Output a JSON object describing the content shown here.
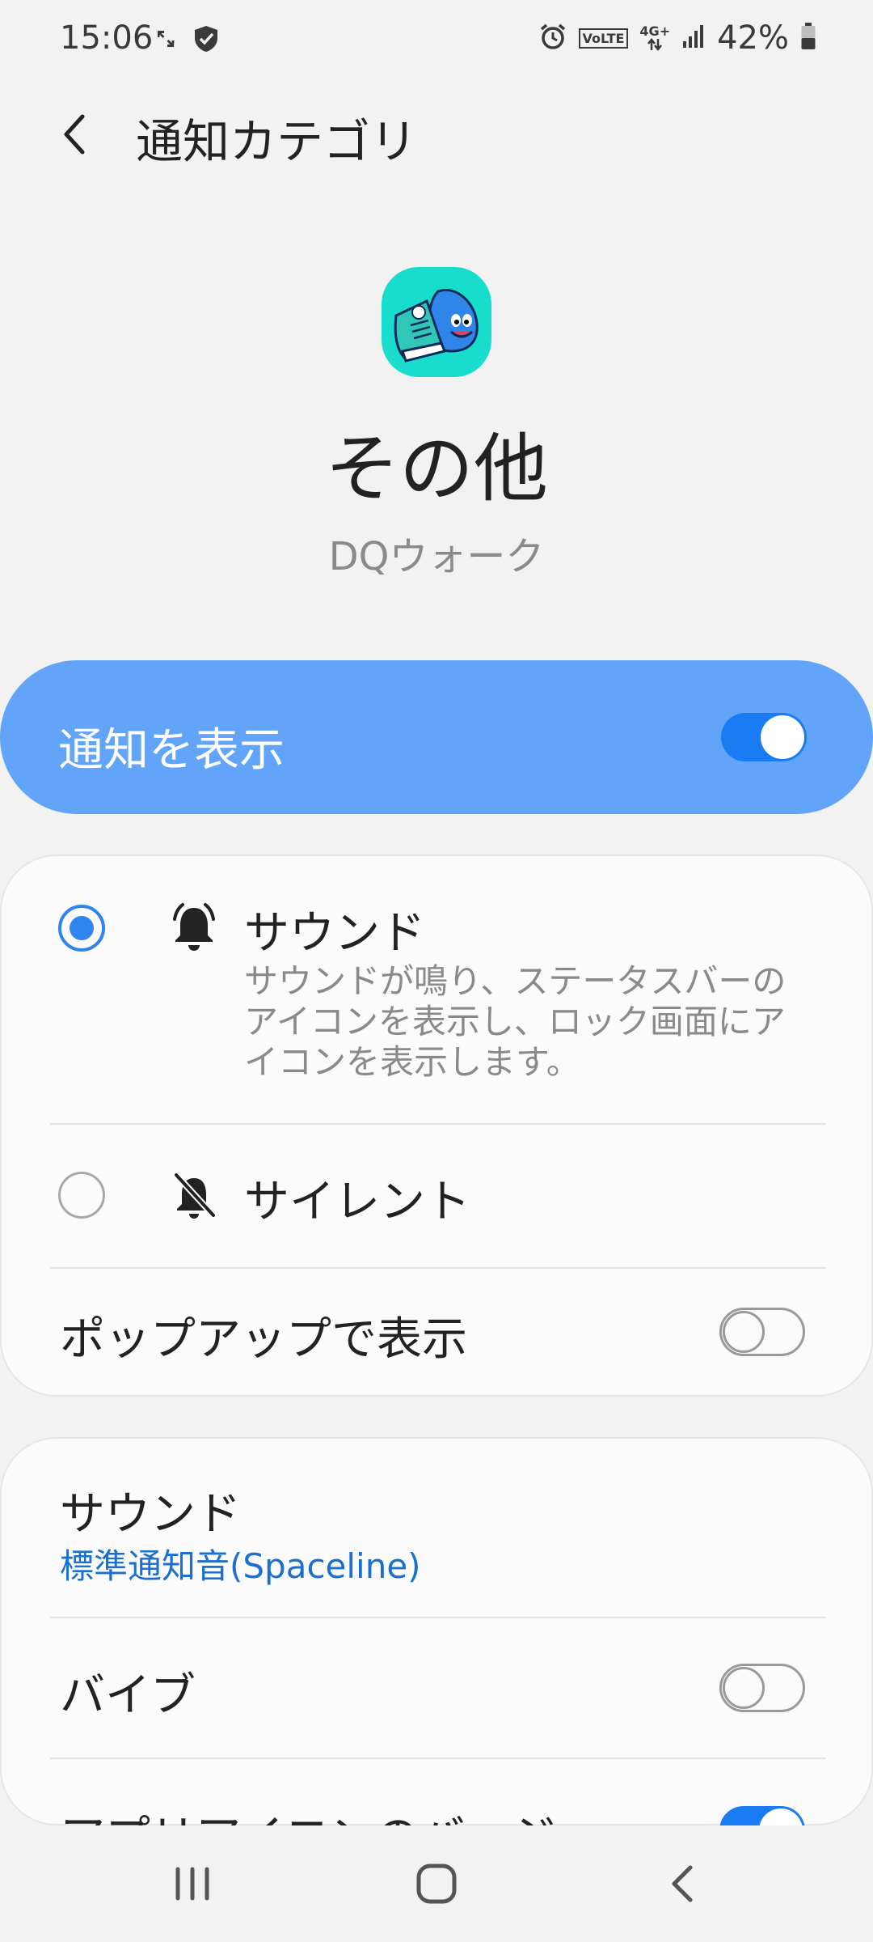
{
  "status_bar": {
    "time": "15:06",
    "battery_percent": "42%",
    "volte": "VoLTE",
    "network": "4G+",
    "icons": [
      "expand-icon",
      "shield-icon",
      "alarm-icon",
      "volte-icon",
      "4g-icon",
      "signal-icon",
      "battery-icon"
    ]
  },
  "header": {
    "title": "通知カテゴリ",
    "back_icon": "back-arrow-icon"
  },
  "app": {
    "category_name": "その他",
    "app_name": "DQウォーク",
    "icon": "dq-walk-app-icon"
  },
  "master_toggle": {
    "label": "通知を表示",
    "on": true
  },
  "alert_options": [
    {
      "title": "サウンド",
      "description": "サウンドが鳴り、ステータスバーのアイコンを表示し、ロック画面にアイコンを表示します。",
      "selected": true,
      "icon": "bell-ringing-icon"
    },
    {
      "title": "サイレント",
      "selected": false,
      "icon": "bell-off-icon"
    }
  ],
  "popup": {
    "label": "ポップアップで表示",
    "on": false
  },
  "settings": {
    "sound": {
      "label": "サウンド",
      "value": "標準通知音(Spaceline)"
    },
    "vibrate": {
      "label": "バイブ",
      "on": false
    },
    "badge": {
      "label": "アプリアイコンのバッジ",
      "on": true
    }
  },
  "colors": {
    "accent": "#1a7cf3",
    "master_bg": "#63a4fb",
    "link": "#1a6fd0"
  },
  "nav": {
    "icons": [
      "recent-apps-icon",
      "home-icon",
      "back-icon"
    ]
  }
}
